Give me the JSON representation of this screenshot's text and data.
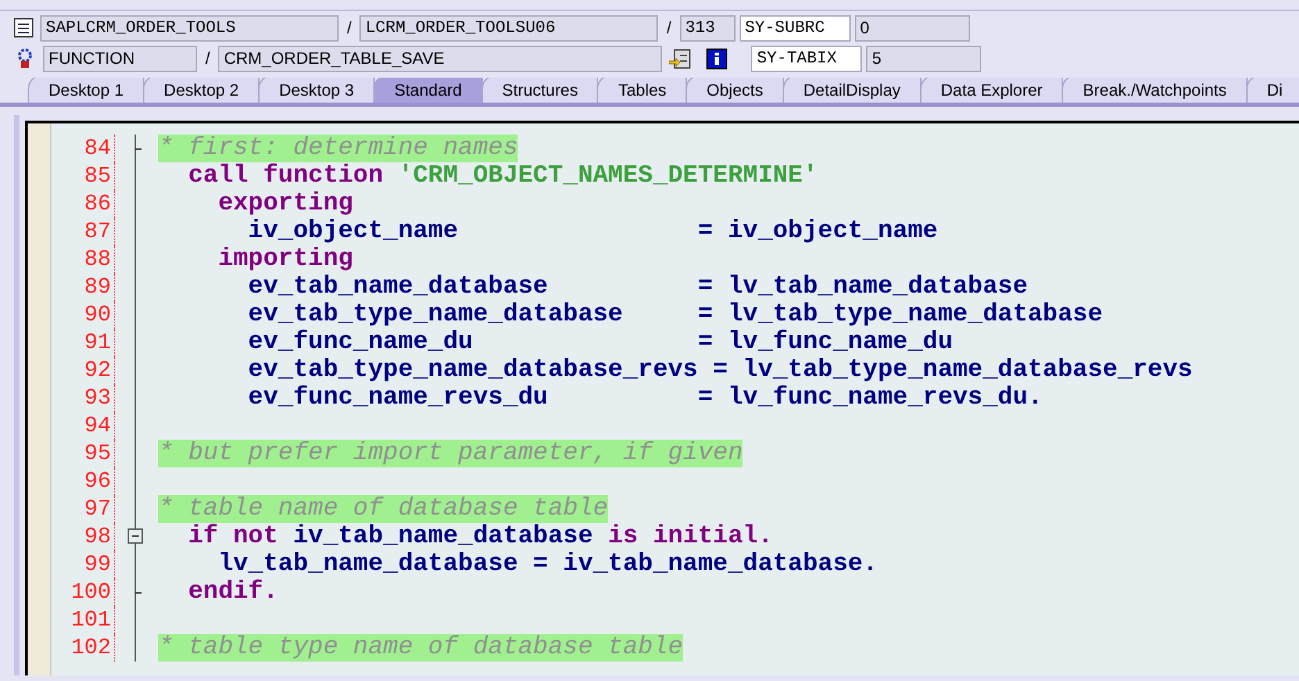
{
  "header": {
    "rows": [
      {
        "fields": [
          {
            "kind": "field",
            "text": "SAPLCRM_ORDER_TOOLS"
          },
          {
            "kind": "sep",
            "text": "/"
          },
          {
            "kind": "field",
            "text": "LCRM_ORDER_TOOLSU06"
          },
          {
            "kind": "sep",
            "text": "/"
          },
          {
            "kind": "field",
            "text": "313"
          }
        ],
        "sysfield": {
          "name": "SY-SUBRC",
          "value": "0"
        }
      },
      {
        "fields": [
          {
            "kind": "field",
            "text": "FUNCTION"
          },
          {
            "kind": "sep",
            "text": "/"
          },
          {
            "kind": "field",
            "text": "CRM_ORDER_TABLE_SAVE"
          },
          {
            "kind": "icons"
          }
        ],
        "sysfield": {
          "name": "SY-TABIX",
          "value": "5"
        }
      }
    ]
  },
  "tabs": [
    {
      "label": "Desktop 1",
      "selected": false
    },
    {
      "label": "Desktop 2",
      "selected": false
    },
    {
      "label": "Desktop 3",
      "selected": false
    },
    {
      "label": "Standard",
      "selected": true
    },
    {
      "label": "Structures",
      "selected": false
    },
    {
      "label": "Tables",
      "selected": false
    },
    {
      "label": "Objects",
      "selected": false
    },
    {
      "label": "DetailDisplay",
      "selected": false
    },
    {
      "label": "Data Explorer",
      "selected": false
    },
    {
      "label": "Break./Watchpoints",
      "selected": false
    },
    {
      "label": "Di",
      "selected": false
    }
  ],
  "code": [
    {
      "number": "84",
      "kind": "end",
      "tokens": [
        {
          "kind": "comment",
          "text": "* first: determine names"
        }
      ]
    },
    {
      "number": "85",
      "kind": "plain",
      "tokens": [
        {
          "kind": "keyword",
          "text": "  call function "
        },
        {
          "kind": "string",
          "text": "'CRM_OBJECT_NAMES_DETERMINE'"
        }
      ]
    },
    {
      "number": "86",
      "kind": "plain",
      "tokens": [
        {
          "kind": "keyword",
          "text": "    exporting"
        }
      ]
    },
    {
      "number": "87",
      "kind": "plain",
      "tokens": [
        {
          "kind": "ident",
          "text": "      iv_object_name                = iv_object_name"
        }
      ]
    },
    {
      "number": "88",
      "kind": "plain",
      "tokens": [
        {
          "kind": "keyword",
          "text": "    importing"
        }
      ]
    },
    {
      "number": "89",
      "kind": "plain",
      "tokens": [
        {
          "kind": "ident",
          "text": "      ev_tab_name_database          = lv_tab_name_database"
        }
      ]
    },
    {
      "number": "90",
      "kind": "plain",
      "tokens": [
        {
          "kind": "ident",
          "text": "      ev_tab_type_name_database     = lv_tab_type_name_database"
        }
      ]
    },
    {
      "number": "91",
      "kind": "plain",
      "tokens": [
        {
          "kind": "ident",
          "text": "      ev_func_name_du               = lv_func_name_du"
        }
      ]
    },
    {
      "number": "92",
      "kind": "plain",
      "tokens": [
        {
          "kind": "ident",
          "text": "      ev_tab_type_name_database_revs = lv_tab_type_name_database_revs"
        }
      ]
    },
    {
      "number": "93",
      "kind": "plain",
      "tokens": [
        {
          "kind": "ident",
          "text": "      ev_func_name_revs_du          = lv_func_name_revs_du."
        }
      ]
    },
    {
      "number": "94",
      "kind": "plain"
    },
    {
      "number": "95",
      "kind": "plain",
      "tokens": [
        {
          "kind": "comment",
          "text": "* but prefer import parameter, if given"
        }
      ]
    },
    {
      "number": "96",
      "kind": "plain"
    },
    {
      "number": "97",
      "kind": "plain",
      "tokens": [
        {
          "kind": "comment",
          "text": "* table name of database table"
        }
      ]
    },
    {
      "number": "98",
      "kind": "toggle",
      "tokens": [
        {
          "kind": "keyword",
          "text": "  if not "
        },
        {
          "kind": "ident",
          "text": "iv_tab_name_database "
        },
        {
          "kind": "keyword",
          "text": "is initial."
        }
      ]
    },
    {
      "number": "99",
      "kind": "plain",
      "tokens": [
        {
          "kind": "ident",
          "text": "    lv_tab_name_database = iv_tab_name_database."
        }
      ]
    },
    {
      "number": "100",
      "kind": "end",
      "tokens": [
        {
          "kind": "keyword",
          "text": "  endif."
        }
      ]
    },
    {
      "number": "101",
      "kind": "plain"
    },
    {
      "number": "102",
      "kind": "plain",
      "tokens": [
        {
          "kind": "comment",
          "text": "* table type name of database table"
        }
      ]
    }
  ]
}
